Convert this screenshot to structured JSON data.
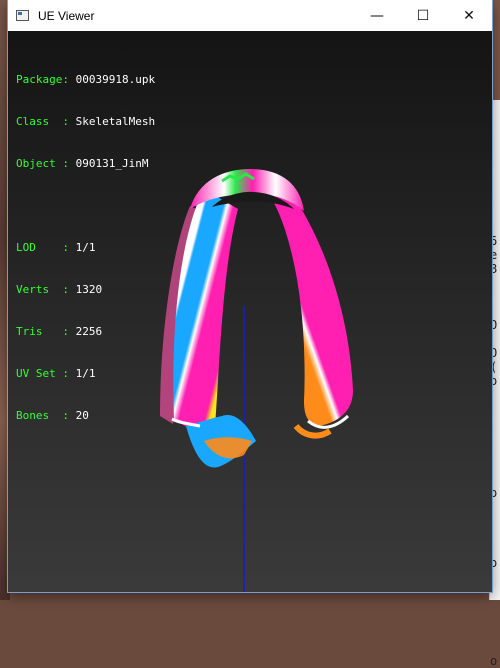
{
  "window": {
    "title": "UE Viewer",
    "controls": {
      "minimize": "—",
      "maximize": "☐",
      "close": "✕"
    }
  },
  "info": {
    "rows": [
      {
        "label": "Package: ",
        "value": "00039918.upk"
      },
      {
        "label": "Class  : ",
        "value": "SkeletalMesh"
      },
      {
        "label": "Object : ",
        "value": "090131_JinM"
      }
    ],
    "stats": [
      {
        "label": "LOD    : ",
        "value": "1/1"
      },
      {
        "label": "Verts  : ",
        "value": "1320"
      },
      {
        "label": "Tris   : ",
        "value": "2256"
      },
      {
        "label": "UV Set : ",
        "value": "1/1"
      },
      {
        "label": "Bones  : ",
        "value": "20"
      }
    ]
  },
  "background": {
    "right_edge_text": "6\ne\n8\n\n\n\nO\n\nO\n(\no\n\n\n\n\n\n\n\no\n\n\n\n\no\n\n\n\n\n\n\no"
  },
  "colors": {
    "info_label": "#33ff33",
    "info_value": "#ffffff",
    "viewport_top": "#141414",
    "viewport_bottom": "#3a3a3a",
    "axis_line": "#1a1acc"
  },
  "icons": {
    "app": "window-app-icon",
    "minimize": "minimize-icon",
    "maximize": "maximize-icon",
    "close": "close-icon"
  }
}
